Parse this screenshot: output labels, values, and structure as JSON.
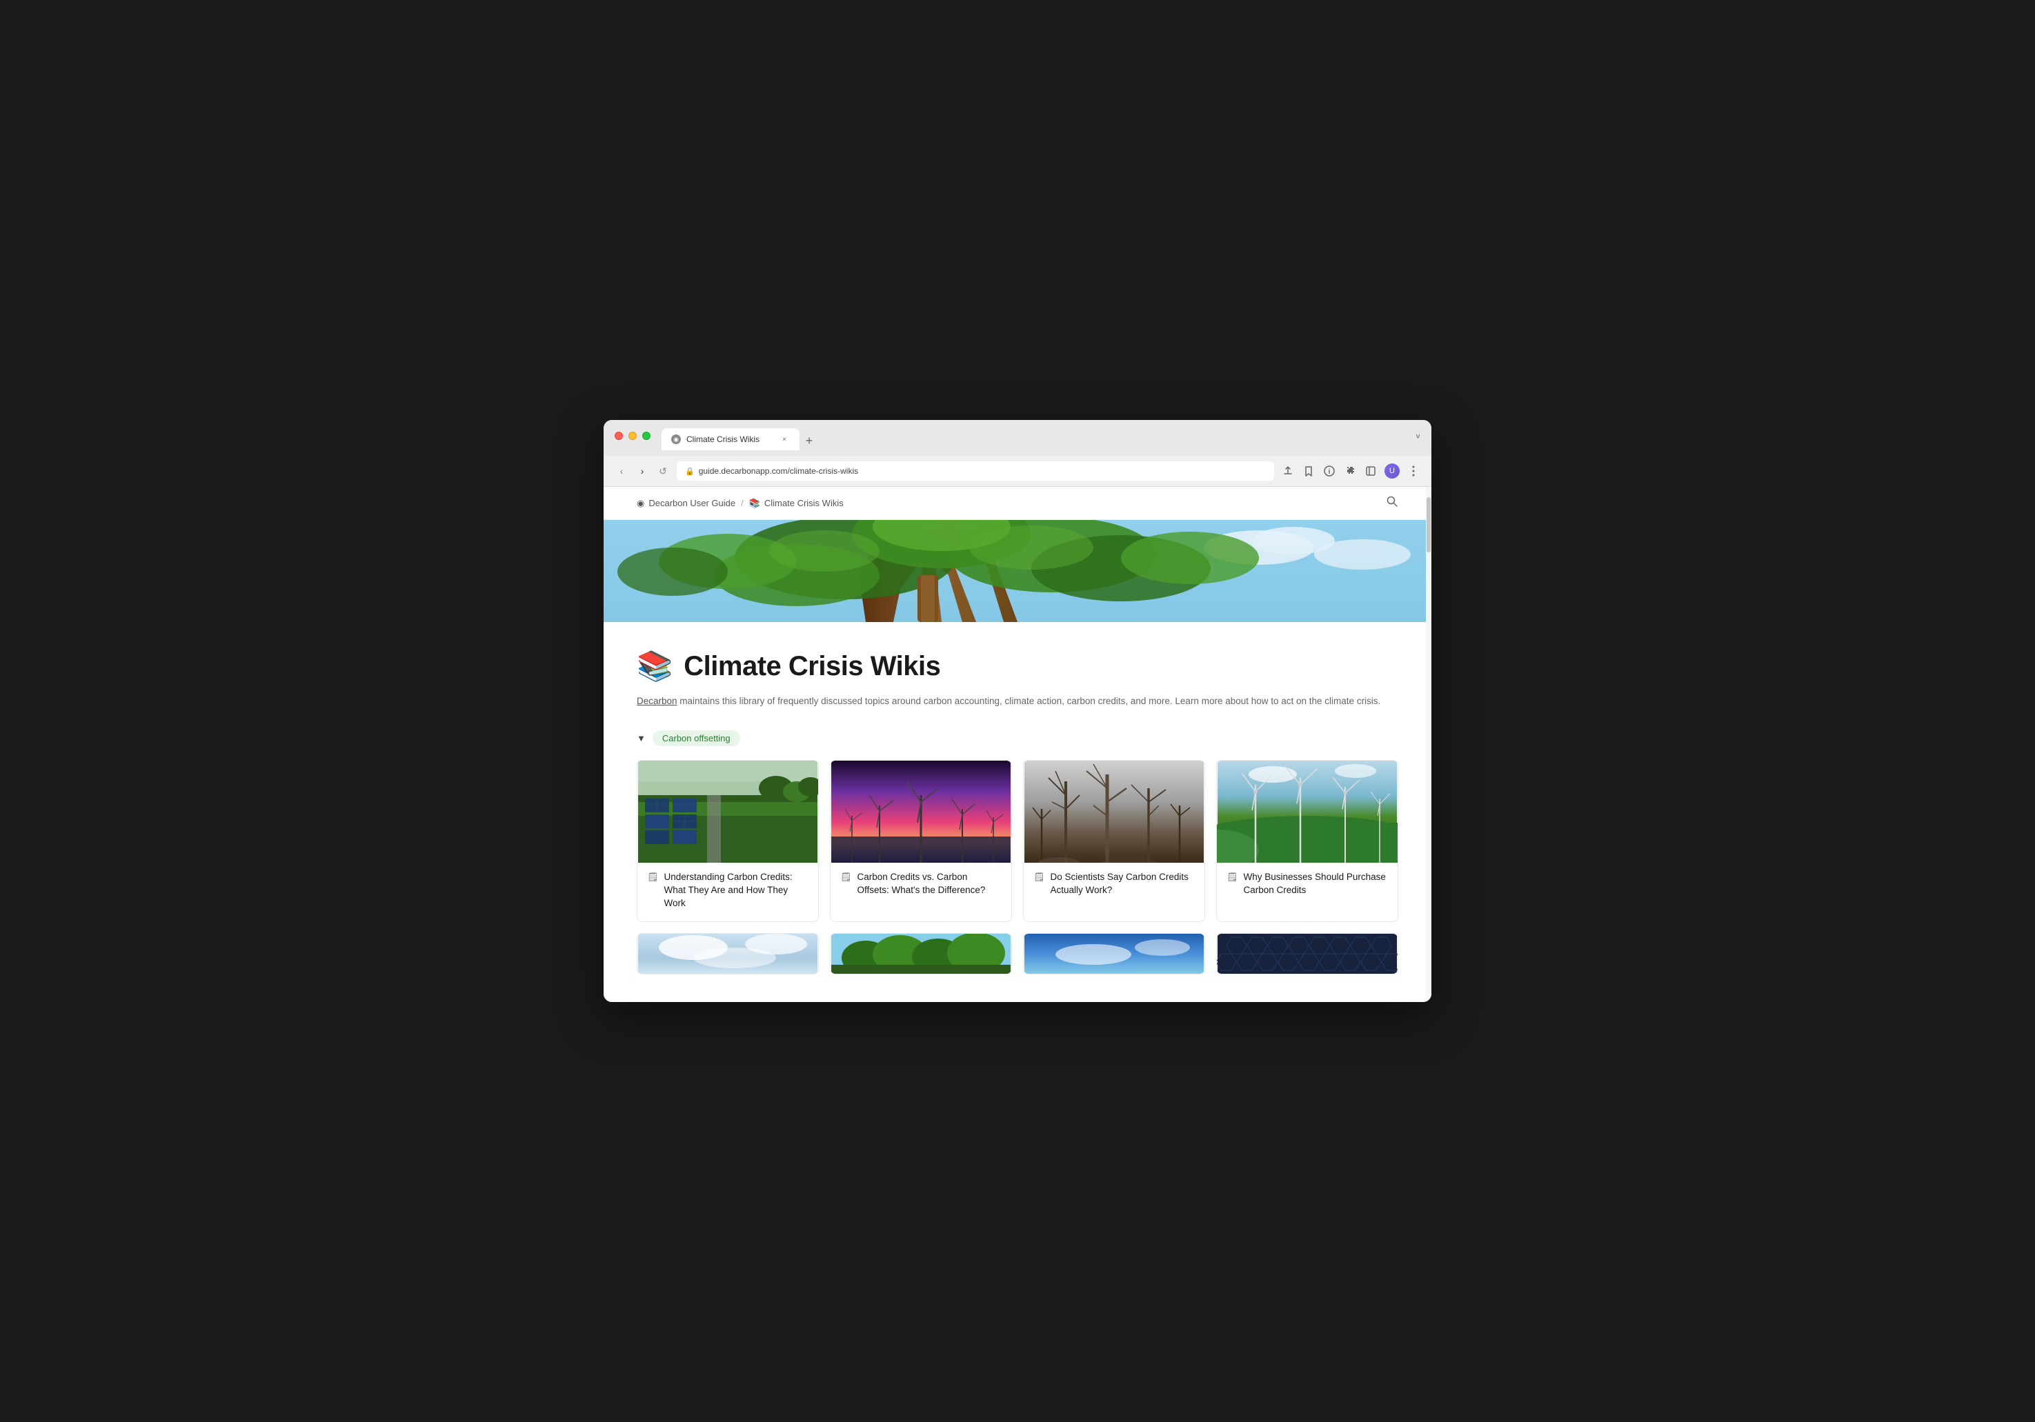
{
  "browser": {
    "tab": {
      "label": "Climate Crisis Wikis",
      "icon": "●",
      "close": "×"
    },
    "new_tab_label": "+",
    "chevron_label": "˅",
    "nav": {
      "back_label": "‹",
      "forward_label": "›",
      "refresh_label": "↺"
    },
    "address": {
      "lock_icon": "🔒",
      "url": "guide.decarbonapp.com/climate-crisis-wikis"
    },
    "toolbar": {
      "share_icon": "⬆",
      "star_icon": "☆",
      "info_icon": "ℹ",
      "puzzle_icon": "🧩",
      "grid_icon": "⊞",
      "more_icon": "⋮"
    }
  },
  "breadcrumb": {
    "home_icon": "◉",
    "home_label": "Decarbon User Guide",
    "separator": "/",
    "current_icon": "📚",
    "current_label": "Climate Crisis Wikis",
    "search_icon": "🔍"
  },
  "page": {
    "emoji": "📚",
    "title": "Climate Crisis Wikis",
    "description_link": "Decarbon",
    "description_text": " maintains this library of frequently discussed topics around carbon accounting, climate action, carbon credits, and more. Learn more about how to act on the climate crisis."
  },
  "section": {
    "toggle_icon": "▼",
    "tag_label": "Carbon offsetting"
  },
  "cards": [
    {
      "id": "card-1",
      "image_type": "solar",
      "doc_icon": "📄",
      "title": "Understanding Carbon Credits: What They Are and How They Work"
    },
    {
      "id": "card-2",
      "image_type": "wind-sunset",
      "doc_icon": "📄",
      "title": "Carbon Credits vs. Carbon Offsets: What's the Difference?"
    },
    {
      "id": "card-3",
      "image_type": "burned",
      "doc_icon": "📄",
      "title": "Do Scientists Say Carbon Credits Actually Work?"
    },
    {
      "id": "card-4",
      "image_type": "wind-green",
      "doc_icon": "📄",
      "title": "Why Businesses Should Purchase Carbon Credits"
    }
  ],
  "cards_row2": [
    {
      "id": "card-5",
      "image_type": "sky",
      "doc_icon": "📄",
      "title": ""
    },
    {
      "id": "card-6",
      "image_type": "forest",
      "doc_icon": "📄",
      "title": ""
    },
    {
      "id": "card-7",
      "image_type": "blue-sky",
      "doc_icon": "📄",
      "title": ""
    },
    {
      "id": "card-8",
      "image_type": "dark-hex",
      "doc_icon": "📄",
      "title": ""
    }
  ]
}
